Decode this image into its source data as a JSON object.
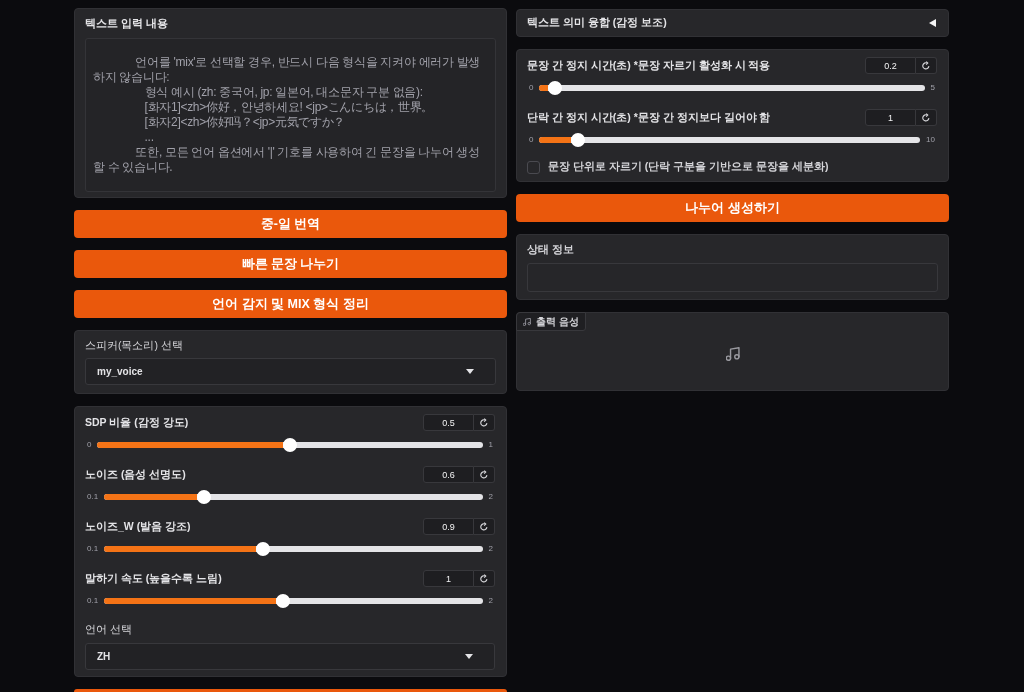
{
  "text_input": {
    "label": "텍스트 입력 내용",
    "placeholder": "              언어를 'mix'로 선택할 경우, 반드시 다음 형식을 지켜야 에러가 발생하지 않습니다:\n                 형식 예시 (zh: 중국어, jp: 일본어, 대소문자 구분 없음):\n                 [화자1]<zh>你好，안녕하세요! <jp>こんにちは，世界。\n                 [화자2]<zh>你好吗？<jp>元気ですか？\n                 ...\n              또한, 모든 언어 옵션에서 '|' 기호를 사용하여 긴 문장을 나누어 생성할 수 있습니다."
  },
  "action_buttons": [
    "중-일 번역",
    "빠른 문장 나누기",
    "언어 감지 및 MIX 형식 정리"
  ],
  "speaker": {
    "label": "스피커(목소리) 선택",
    "value": "my_voice"
  },
  "voice_sliders": [
    {
      "label": "SDP 비율 (감정 강도)",
      "value": "0.5",
      "min": "0",
      "max": "1",
      "level": 0.5
    },
    {
      "label": "노이즈 (음성 선명도)",
      "value": "0.6",
      "min": "0.1",
      "max": "2",
      "level": 0.263
    },
    {
      "label": "노이즈_W (발음 강조)",
      "value": "0.9",
      "min": "0.1",
      "max": "2",
      "level": 0.421
    },
    {
      "label": "말하기 속도 (높을수록 느림)",
      "value": "1",
      "min": "0.1",
      "max": "2",
      "level": 0.474
    }
  ],
  "language": {
    "label": "언어 선택",
    "value": "ZH"
  },
  "cut_off_button": {
    "kind": "primary"
  },
  "fusion_accordion": {
    "title": "텍스트 의미 융합 (감정 보조)",
    "expanded": false
  },
  "pause_sliders": [
    {
      "label": "문장 간 정지 시간(초) *문장 자르기 활성화 시 적용",
      "value": "0.2",
      "min": "0",
      "max": "5",
      "level": 0.04
    },
    {
      "label": "단락 간 정지 시간(초) *문장 간 정지보다 길어야 함",
      "value": "1",
      "min": "0",
      "max": "10",
      "level": 0.1
    }
  ],
  "split_checkbox": {
    "label": "문장 단위로 자르기 (단락 구분을 기반으로 문장을 세분화)",
    "checked": false
  },
  "generate_button": "나누어 생성하기",
  "status": {
    "label": "상태 정보"
  },
  "output_audio": {
    "label": "출력 음성"
  }
}
